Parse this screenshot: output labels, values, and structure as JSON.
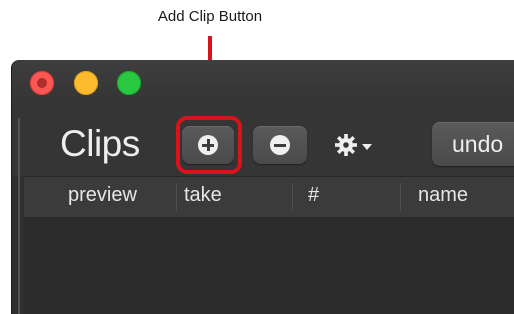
{
  "annotation": {
    "label": "Add Clip Button",
    "color": "#d9121b"
  },
  "window": {
    "buttons": [
      "close",
      "minimize",
      "zoom"
    ],
    "colors": {
      "close": "#fd5753",
      "minimize": "#fdbc2e",
      "zoom": "#28c840"
    }
  },
  "toolbar": {
    "title": "Clips",
    "add_icon": "plus-circle-icon",
    "remove_icon": "minus-circle-icon",
    "action_icon": "gear-dropdown-icon",
    "undo_label": "undo"
  },
  "table": {
    "columns": [
      "preview",
      "take",
      "#",
      "name"
    ],
    "rows": []
  }
}
